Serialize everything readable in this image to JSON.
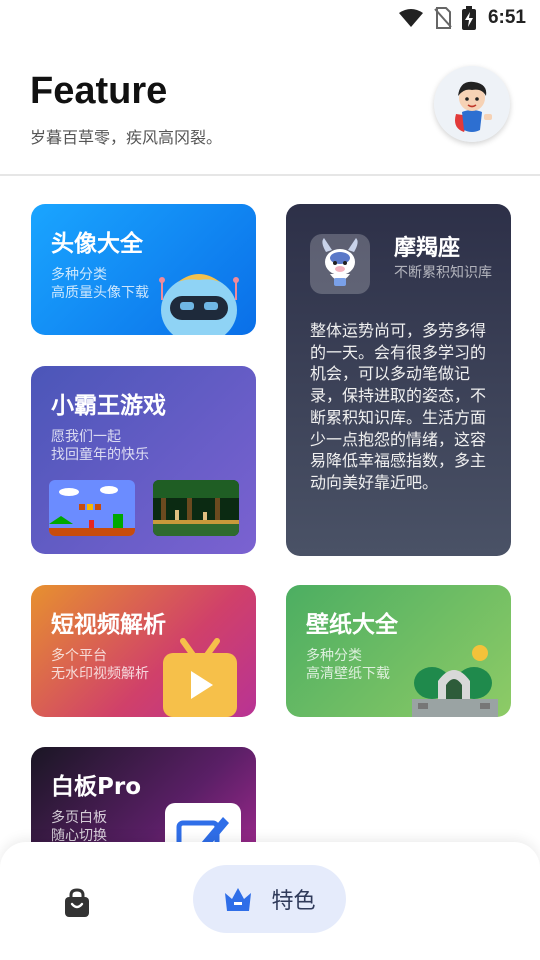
{
  "status_bar": {
    "time": "6:51"
  },
  "header": {
    "title": "Feature",
    "subtitle": "岁暮百草零，疾风高冈裂。"
  },
  "cards": {
    "avatar": {
      "title": "头像大全",
      "line1": "多种分类",
      "line2": "高质量头像下载"
    },
    "game": {
      "title": "小霸王游戏",
      "line1": "愿我们一起",
      "line2": "找回童年的快乐"
    },
    "video": {
      "title": "短视频解析",
      "line1": "多个平台",
      "line2": "无水印视频解析"
    },
    "board": {
      "title": "白板Pro",
      "line1": "多页白板",
      "line2": "随心切换"
    },
    "zodiac": {
      "name": "摩羯座",
      "tagline": "不断累积知识库",
      "text": "整体运势尚可，多劳多得的一天。会有很多学习的机会，可以多动笔做记录，保持进取的姿态，不断累积知识库。生活方面少一点抱怨的情绪，这容易降低幸福感指数，多主动向美好靠近吧。"
    },
    "wallpaper": {
      "title": "壁纸大全",
      "line1": "多种分类",
      "line2": "高清壁纸下载"
    }
  },
  "bottom_nav": {
    "items": [
      {
        "icon": "shopping-bag-icon",
        "label": ""
      },
      {
        "icon": "crown-icon",
        "label": "特色",
        "active": true
      }
    ]
  },
  "colors": {
    "accent": "#2f6ee8",
    "nav_active_bg": "#e5ebfb"
  }
}
